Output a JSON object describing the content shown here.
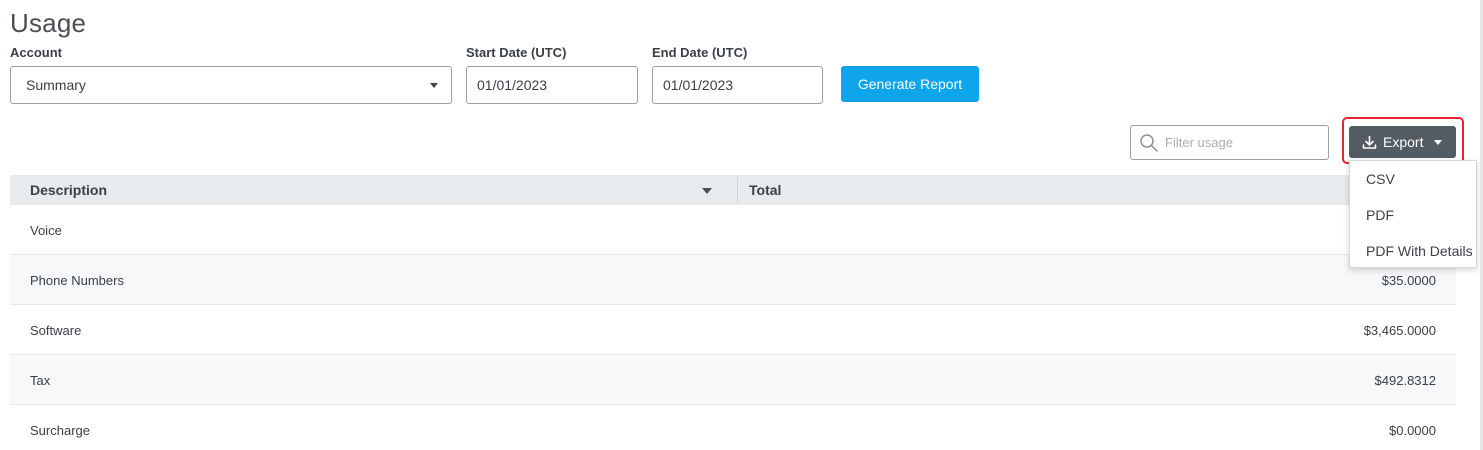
{
  "page": {
    "title": "Usage"
  },
  "filters": {
    "account_label": "Account",
    "account_value": "Summary",
    "start_label": "Start Date (UTC)",
    "start_value": "01/01/2023",
    "end_label": "End Date (UTC)",
    "end_value": "01/01/2023",
    "generate_label": "Generate Report"
  },
  "toolbar": {
    "filter_placeholder": "Filter usage",
    "export_label": "Export",
    "export_menu": [
      "CSV",
      "PDF",
      "PDF With Details"
    ]
  },
  "table": {
    "columns": [
      "Description",
      "Total"
    ],
    "rows": [
      {
        "description": "Voice",
        "total": ""
      },
      {
        "description": "Phone Numbers",
        "total": "$35.0000"
      },
      {
        "description": "Software",
        "total": "$3,465.0000"
      },
      {
        "description": "Tax",
        "total": "$492.8312"
      },
      {
        "description": "Surcharge",
        "total": "$0.0000"
      }
    ]
  },
  "colors": {
    "primary": "#0ea5ea",
    "export_button": "#535b63",
    "highlight": "#e5252d",
    "header_bg": "#e8ebee"
  },
  "icons": {
    "account_dropdown": "caret-down-icon",
    "filter": "search-icon",
    "export": "download-icon",
    "export_dropdown": "caret-down-icon",
    "sort": "sort-desc-icon"
  }
}
